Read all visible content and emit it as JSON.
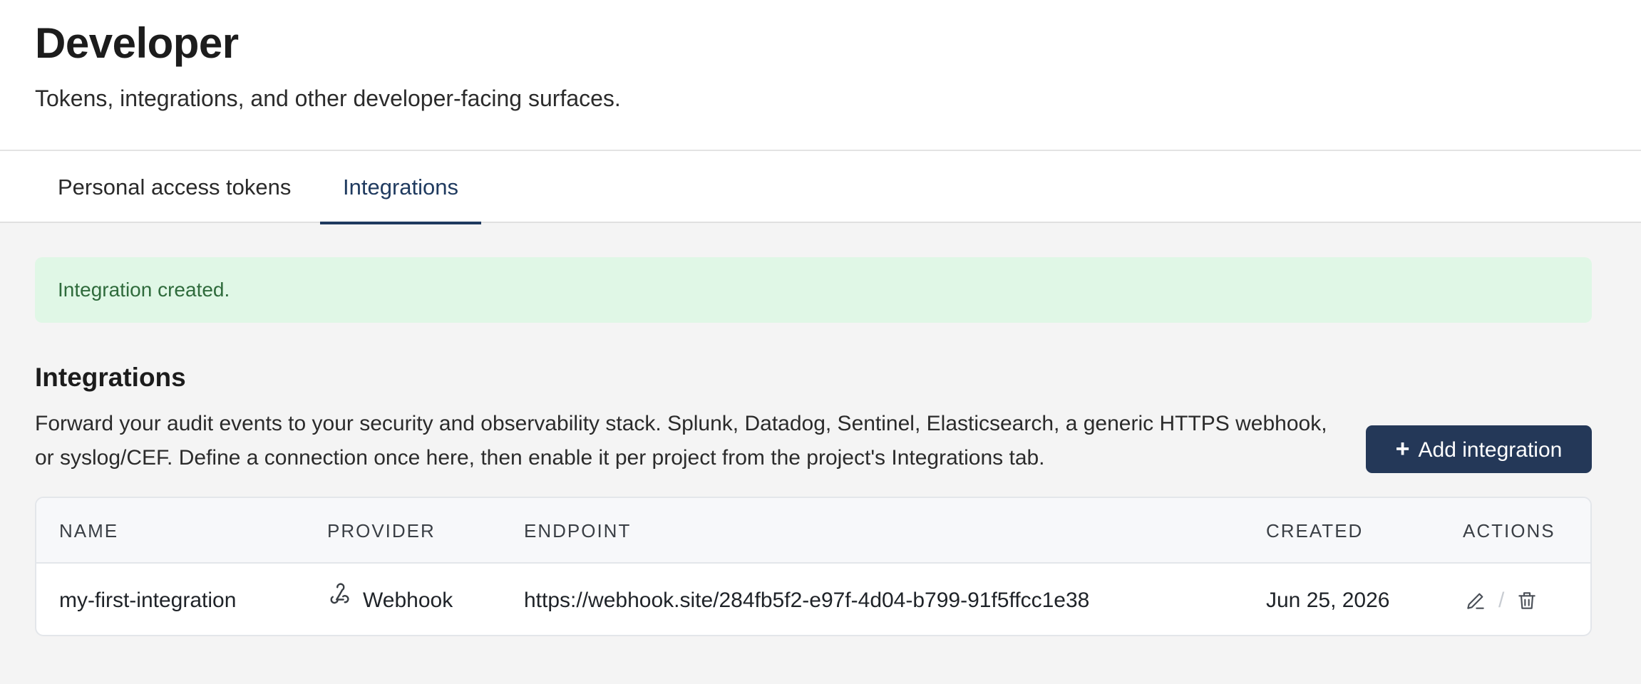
{
  "header": {
    "title": "Developer",
    "subtitle": "Tokens, integrations, and other developer-facing surfaces."
  },
  "tabs": [
    {
      "label": "Personal access tokens",
      "active": false
    },
    {
      "label": "Integrations",
      "active": true
    }
  ],
  "alert": {
    "message": "Integration created.",
    "color": "#2f6b3c",
    "background": "#e0f7e6"
  },
  "section": {
    "title": "Integrations",
    "description": "Forward your audit events to your security and observability stack. Splunk, Datadog, Sentinel, Elasticsearch, a generic HTTPS webhook, or syslog/CEF. Define a connection once here, then enable it per project from the project's Integrations tab.",
    "add_button": "Add integration"
  },
  "table": {
    "columns": [
      "NAME",
      "PROVIDER",
      "ENDPOINT",
      "CREATED",
      "ACTIONS"
    ],
    "rows": [
      {
        "name": "my-first-integration",
        "provider": "Webhook",
        "provider_icon": "webhook-icon",
        "endpoint": "https://webhook.site/284fb5f2-e97f-4d04-b799-91f5ffcc1e38",
        "created": "Jun 25, 2026",
        "actions": [
          "edit-icon",
          "trash-icon"
        ]
      }
    ]
  },
  "colors": {
    "accent": "#1f3a5f",
    "button": "#243858"
  }
}
